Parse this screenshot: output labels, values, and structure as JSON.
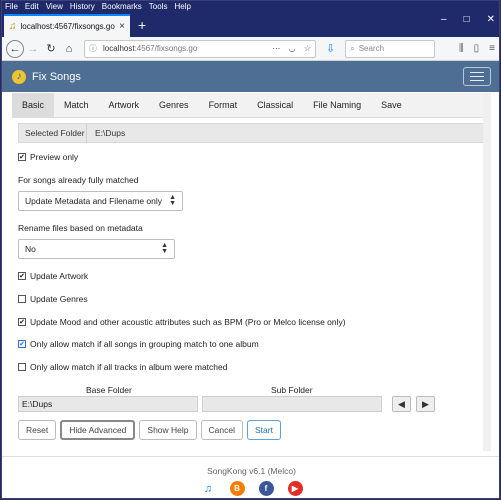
{
  "browser": {
    "menu": [
      "File",
      "Edit",
      "View",
      "History",
      "Bookmarks",
      "Tools",
      "Help"
    ],
    "tab": {
      "title": "localhost:4567/fixsongs.go",
      "icon": "music-note-icon",
      "close": "×"
    },
    "new_tab": "+",
    "window_controls": {
      "minimize": "–",
      "maximize": "□",
      "close": "✕"
    },
    "url": {
      "host": "localhost",
      "rest": ":4567/fixsongs.go"
    },
    "search_placeholder": "Search"
  },
  "app": {
    "title": "Fix Songs",
    "tabs": [
      "Basic",
      "Match",
      "Artwork",
      "Genres",
      "Format",
      "Classical",
      "File Naming",
      "Save"
    ],
    "active_tab": "Basic",
    "selected_folder": {
      "label": "Selected Folder",
      "value": "E:\\Dups"
    },
    "preview_only": {
      "label": "Preview only",
      "checked": true
    },
    "fully_matched": {
      "label": "For songs already fully matched",
      "value": "Update Metadata and Filename only"
    },
    "rename": {
      "label": "Rename files based on metadata",
      "value": "No"
    },
    "options": [
      {
        "label": "Update Artwork",
        "checked": true
      },
      {
        "label": "Update Genres",
        "checked": false
      },
      {
        "label": "Update Mood and other acoustic attributes such as BPM (Pro or Melco license only)",
        "checked": true
      },
      {
        "label": "Only allow match if all songs in grouping match to one album",
        "checked": true
      },
      {
        "label": "Only allow match if all tracks in album were matched",
        "checked": false
      }
    ],
    "base_folder": {
      "label": "Base Folder",
      "value": "E:\\Dups"
    },
    "sub_folder": {
      "label": "Sub Folder",
      "value": ""
    },
    "buttons": {
      "reset": "Reset",
      "hide_advanced": "Hide Advanced",
      "show_help": "Show Help",
      "cancel": "Cancel",
      "start": "Start"
    },
    "footer": {
      "version": "SongKong v6.1 (Melco)"
    }
  },
  "colors": {
    "header": "#4e6f93",
    "titlebar": "#1f2a6a",
    "primary_button_border": "#5aa2d8"
  }
}
